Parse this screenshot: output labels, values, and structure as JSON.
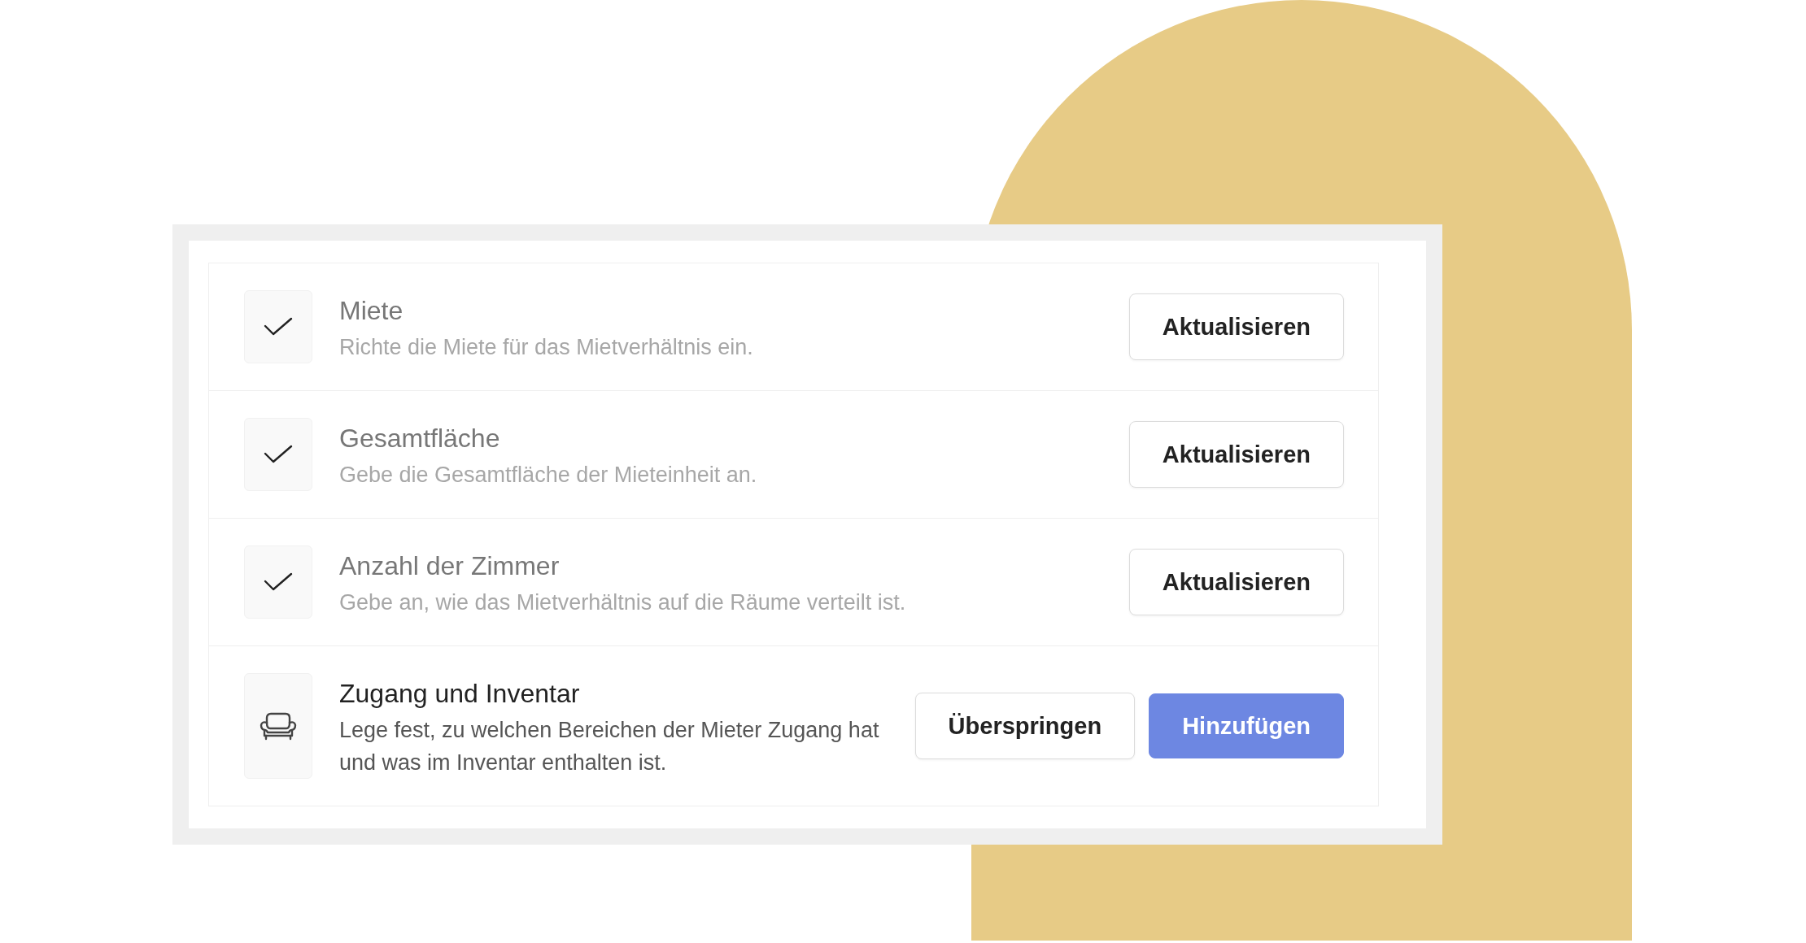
{
  "tasks": [
    {
      "title": "Miete",
      "description": "Richte die Miete für das Mietverhältnis ein.",
      "done": true,
      "buttons": [
        {
          "label": "Aktualisieren",
          "kind": "secondary"
        }
      ]
    },
    {
      "title": "Gesamtfläche",
      "description": "Gebe die Gesamtfläche der Mieteinheit an.",
      "done": true,
      "buttons": [
        {
          "label": "Aktualisieren",
          "kind": "secondary"
        }
      ]
    },
    {
      "title": "Anzahl der Zimmer",
      "description": "Gebe an, wie das Mietverhältnis auf die Räume verteilt ist.",
      "done": true,
      "buttons": [
        {
          "label": "Aktualisieren",
          "kind": "secondary"
        }
      ]
    },
    {
      "title": "Zugang und Inventar",
      "description": "Lege fest, zu welchen Bereichen der Mieter Zugang hat und was im Inventar enthalten ist.",
      "done": false,
      "buttons": [
        {
          "label": "Überspringen",
          "kind": "secondary"
        },
        {
          "label": "Hinzufügen",
          "kind": "primary"
        }
      ]
    }
  ]
}
